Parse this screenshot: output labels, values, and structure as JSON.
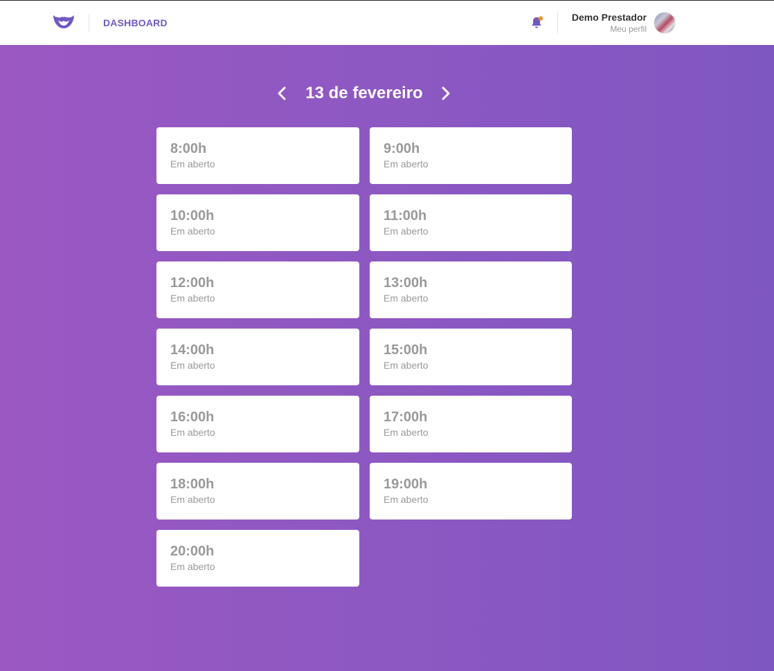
{
  "header": {
    "logo_icon": "mustache-logo-icon",
    "nav_label": "DASHBOARD",
    "notification_icon": "bell-icon",
    "notification_dot_color": "#f7931e",
    "profile": {
      "name": "Demo Prestador",
      "link_label": "Meu perfil"
    }
  },
  "date_nav": {
    "prev_icon": "chevron-left-icon",
    "title": "13 de fevereiro",
    "next_icon": "chevron-right-icon"
  },
  "slots": [
    {
      "time": "8:00h",
      "status": "Em aberto"
    },
    {
      "time": "9:00h",
      "status": "Em aberto"
    },
    {
      "time": "10:00h",
      "status": "Em aberto"
    },
    {
      "time": "11:00h",
      "status": "Em aberto"
    },
    {
      "time": "12:00h",
      "status": "Em aberto"
    },
    {
      "time": "13:00h",
      "status": "Em aberto"
    },
    {
      "time": "14:00h",
      "status": "Em aberto"
    },
    {
      "time": "15:00h",
      "status": "Em aberto"
    },
    {
      "time": "16:00h",
      "status": "Em aberto"
    },
    {
      "time": "17:00h",
      "status": "Em aberto"
    },
    {
      "time": "18:00h",
      "status": "Em aberto"
    },
    {
      "time": "19:00h",
      "status": "Em aberto"
    },
    {
      "time": "20:00h",
      "status": "Em aberto"
    }
  ],
  "colors": {
    "accent": "#7159c1",
    "background_start": "#9b58c3",
    "background_end": "#7f57c1"
  }
}
